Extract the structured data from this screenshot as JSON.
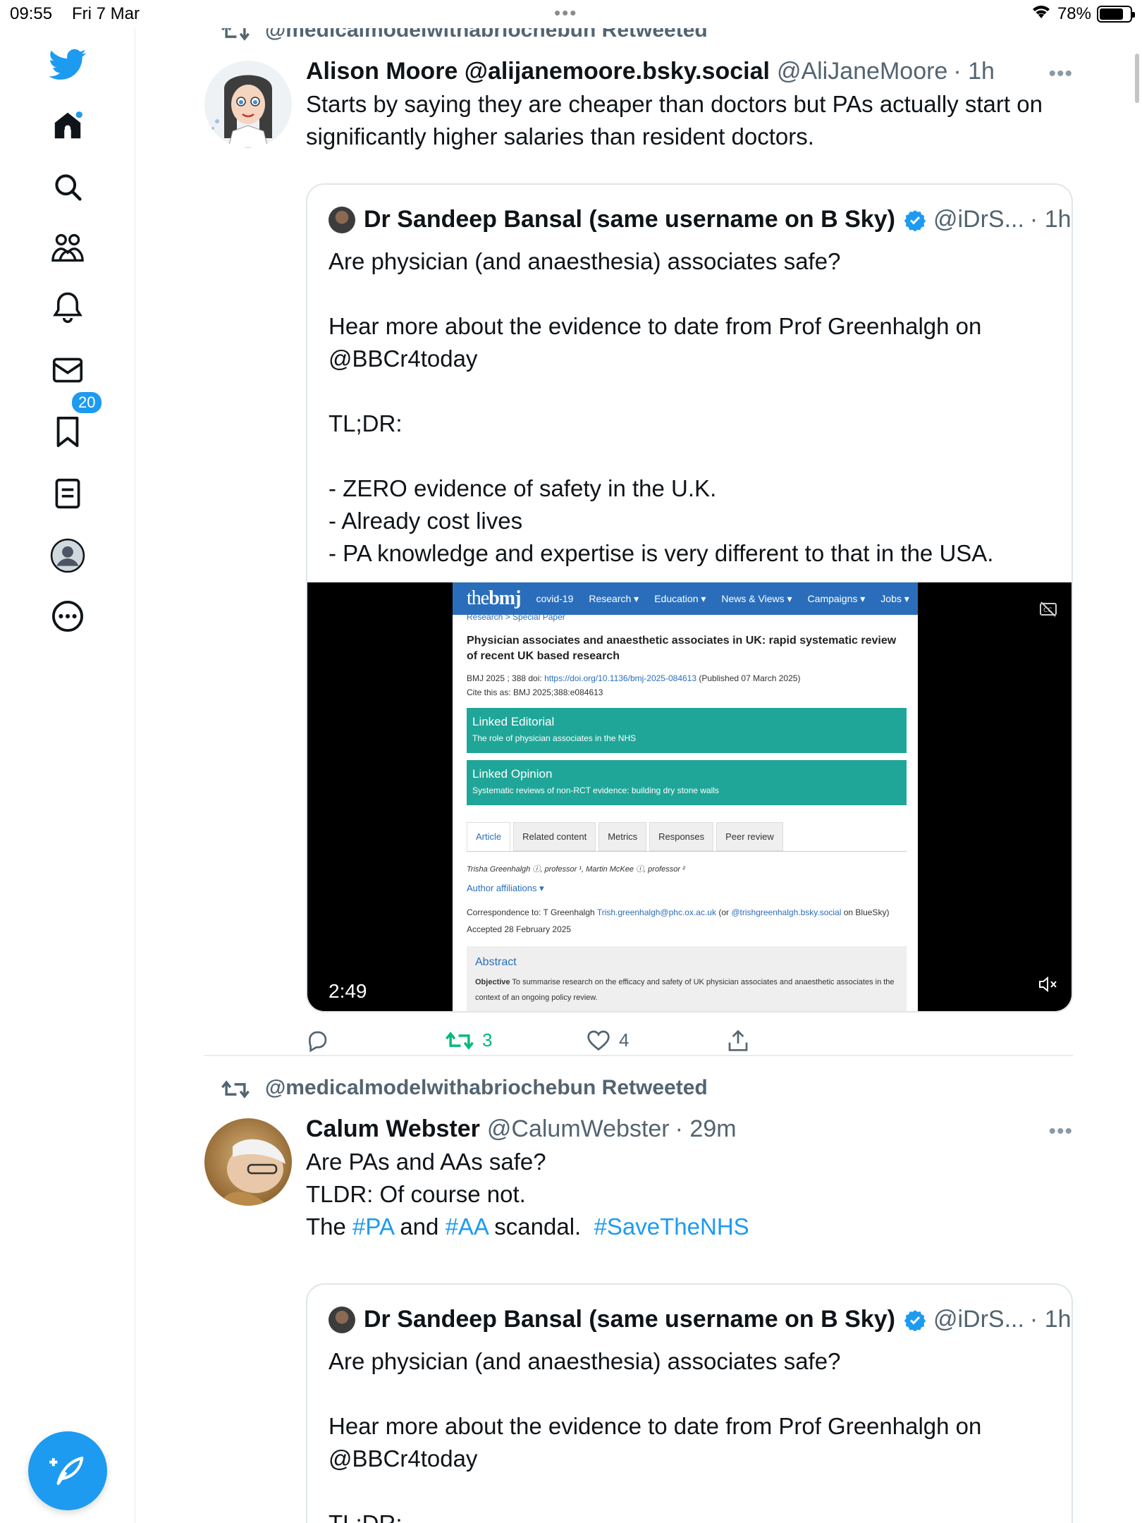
{
  "status_bar": {
    "time": "09:55",
    "date": "Fri 7 Mar",
    "battery": "78%",
    "battery_level": 0.78
  },
  "sidebar": {
    "items": [
      {
        "name": "home",
        "icon": "home-icon"
      },
      {
        "name": "explore",
        "icon": "search-icon"
      },
      {
        "name": "communities",
        "icon": "people-icon"
      },
      {
        "name": "notifications",
        "icon": "bell-icon",
        "badge": "20"
      },
      {
        "name": "messages",
        "icon": "mail-icon"
      },
      {
        "name": "bookmarks",
        "icon": "bookmark-icon"
      },
      {
        "name": "lists",
        "icon": "list-icon"
      },
      {
        "name": "profile",
        "icon": "profile-icon"
      },
      {
        "name": "more",
        "icon": "more-circle-icon"
      }
    ]
  },
  "tweets": [
    {
      "retweeted_by": "@medicalmodelwithabriochebun Retweeted",
      "author": "Alison Moore @alijanemoore.bsky.social",
      "handle": "@AliJaneMoore",
      "time": "· 1h",
      "text": "Starts by saying they are cheaper than doctors but PAs actually start on significantly higher salaries than resident doctors.",
      "quote": {
        "author": "Dr Sandeep Bansal (same username on B Sky)",
        "handle": "@iDrS...",
        "time": "· 1h",
        "lines": [
          "Are physician (and anaesthesia) associates safe?",
          "",
          "Hear more about the evidence to date from Prof Greenhalgh on @BBCr4today",
          "",
          "TL;DR:",
          "",
          "- ZERO evidence of safety in the U.K.",
          "- Already cost lives",
          "- PA knowledge and expertise is very different to that in the USA."
        ],
        "video": {
          "duration": "2:49",
          "bmj": {
            "logo_a": "the",
            "logo_b": "bmj",
            "nav": [
              "covid-19",
              "Research ▾",
              "Education ▾",
              "News & Views ▾",
              "Campaigns ▾",
              "Jobs ▾"
            ],
            "crumb": "Research > Special Paper",
            "title": "Physician associates and anaesthetic associates in UK: rapid systematic review of recent UK based research",
            "meta_1": "BMJ 2025 ; 388 doi:",
            "doi": "https://doi.org/10.1136/bmj-2025-084613",
            "meta_published": "(Published 07 March 2025)",
            "meta_2": "Cite this as: BMJ 2025;388:e084613",
            "linked_editorial": "Linked Editorial",
            "linked_editorial_sub": "The role of physician associates in the NHS",
            "linked_opinion": "Linked Opinion",
            "linked_opinion_sub": "Systematic reviews of non-RCT evidence: building dry stone walls",
            "tabs": [
              "Article",
              "Related content",
              "Metrics",
              "Responses",
              "Peer review"
            ],
            "authors": "Trisha Greenhalgh ⓘ, professor ¹, Martin McKee ⓘ, professor ²",
            "affiliations": "Author affiliations ▾",
            "correspondence": "Correspondence to: T Greenhalgh",
            "corr_email": "Trish.greenhalgh@phc.ox.ac.uk",
            "corr_or": "(or",
            "corr_bsky": "@trishgreenhalgh.bsky.social",
            "corr_end": "on BlueSky)",
            "accepted": "Accepted 28 February 2025",
            "abstract_heading": "Abstract",
            "abstract_label": "Objective",
            "abstract_text": "To summarise research on the efficacy and safety of UK physician associates and anaesthetic associates in the context of an ongoing policy review."
          }
        }
      },
      "actions": {
        "reply": "",
        "retweets": "3",
        "likes": "4",
        "share": ""
      }
    },
    {
      "retweeted_by": "@medicalmodelwithabriochebun Retweeted",
      "author": "Calum Webster",
      "handle": "@CalumWebster",
      "time": "· 29m",
      "text_line_1": "Are PAs and AAs safe?",
      "text_line_2": "TLDR: Of course not.",
      "text_line_3_a": "The",
      "hashtag_pa": "#PA",
      "text_line_3_b": "and",
      "hashtag_aa": "#AA",
      "text_line_3_c": "scandal.",
      "hashtag_nhs": "#SaveTheNHS",
      "quote": {
        "author": "Dr Sandeep Bansal (same username on B Sky)",
        "handle": "@iDrS...",
        "time": "· 1h",
        "lines": [
          "Are physician (and anaesthesia) associates safe?",
          "",
          "Hear more about the evidence to date from Prof Greenhalgh on @BBCr4today",
          "",
          "TL;DR:"
        ]
      }
    }
  ],
  "colors": {
    "accent": "#1d9bf0",
    "retweet_green": "#00ba7c",
    "muted": "#536471",
    "bmj_blue": "#2a6ebb",
    "bmj_teal": "#1fa698"
  }
}
